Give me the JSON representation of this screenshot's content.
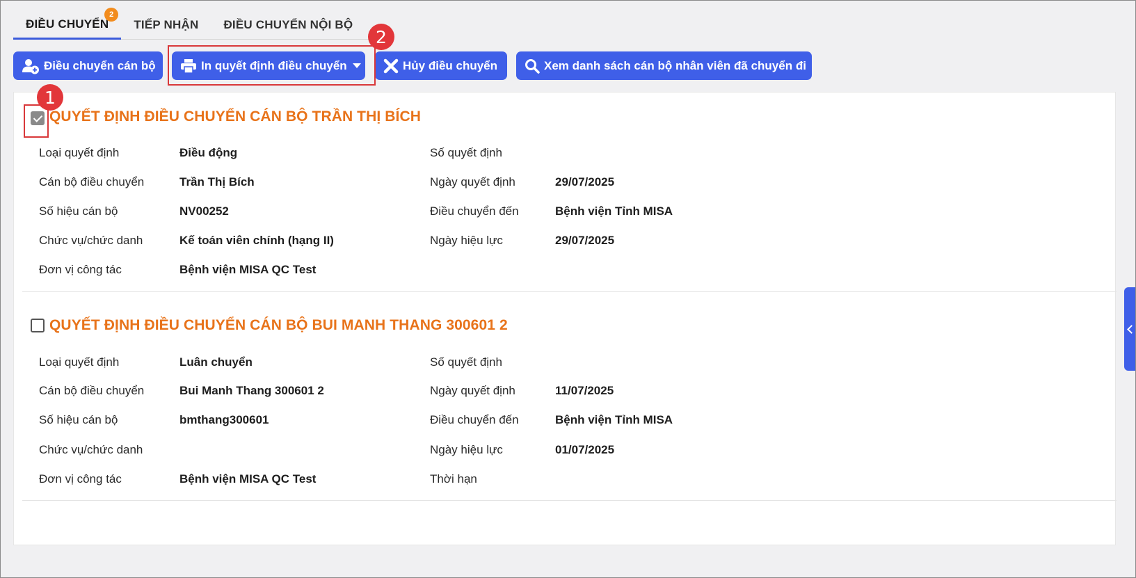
{
  "tabs": [
    {
      "label": "ĐIỀU CHUYỂN",
      "badge": "2",
      "active": true
    },
    {
      "label": "TIẾP NHẬN",
      "active": false
    },
    {
      "label": "ĐIỀU CHUYỂN NỘI BỘ",
      "active": false
    }
  ],
  "toolbar": {
    "transfer_label": "Điều chuyển cán bộ",
    "print_label": "In quyết định điều chuyển",
    "cancel_label": "Hủy điều chuyển",
    "view_list_label": "Xem danh sách cán bộ nhân viên đã chuyển đi"
  },
  "annotations": {
    "step1": "1",
    "step2": "2"
  },
  "records": [
    {
      "title": "QUYẾT ĐỊNH ĐIỀU CHUYỂN CÁN BỘ TRẦN THỊ BÍCH",
      "checked": true,
      "left": [
        {
          "label": "Loại quyết định",
          "value": "Điều động"
        },
        {
          "label": "Cán bộ điều chuyển",
          "value": "Trần Thị Bích"
        },
        {
          "label": "Số hiệu cán bộ",
          "value": "NV00252"
        },
        {
          "label": "Chức vụ/chức danh",
          "value": "Kế toán viên chính (hạng II)"
        },
        {
          "label": "Đơn vị công tác",
          "value": "Bệnh viện MISA QC Test"
        }
      ],
      "right": [
        {
          "label": "Số quyết định",
          "value": ""
        },
        {
          "label": "Ngày quyết định",
          "value": "29/07/2025"
        },
        {
          "label": "Điều chuyển đến",
          "value": "Bệnh viện Tỉnh MISA"
        },
        {
          "label": "Ngày hiệu lực",
          "value": "29/07/2025"
        }
      ]
    },
    {
      "title": "QUYẾT ĐỊNH ĐIỀU CHUYỂN CÁN BỘ BUI MANH THANG 300601 2",
      "checked": false,
      "left": [
        {
          "label": "Loại quyết định",
          "value": "Luân chuyển"
        },
        {
          "label": "Cán bộ điều chuyển",
          "value": "Bui Manh Thang 300601 2"
        },
        {
          "label": "Số hiệu cán bộ",
          "value": "bmthang300601"
        },
        {
          "label": "Chức vụ/chức danh",
          "value": ""
        },
        {
          "label": "Đơn vị công tác",
          "value": "Bệnh viện MISA QC Test"
        }
      ],
      "right": [
        {
          "label": "Số quyết định",
          "value": ""
        },
        {
          "label": "Ngày quyết định",
          "value": "11/07/2025"
        },
        {
          "label": "Điều chuyển đến",
          "value": "Bệnh viện Tỉnh MISA"
        },
        {
          "label": "Ngày hiệu lực",
          "value": "01/07/2025"
        },
        {
          "label": "Thời hạn",
          "value": ""
        }
      ]
    }
  ],
  "colors": {
    "accent": "#3f5fe8",
    "title": "#e8731a",
    "badge": "#f28c1e",
    "highlight": "#d9383a"
  }
}
